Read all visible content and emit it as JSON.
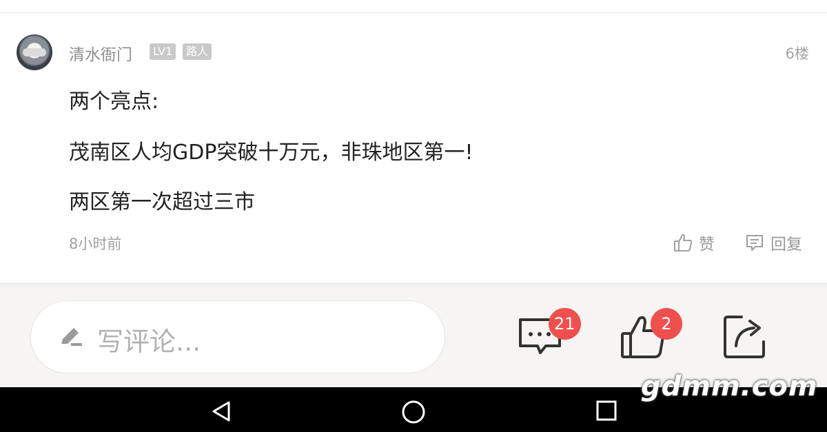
{
  "comment": {
    "username": "清水衙门",
    "level_badge": "LV1",
    "role_badge": "路人",
    "floor": "6楼",
    "lines": [
      "两个亮点:",
      "茂南区人均GDP突破十万元，非珠地区第一!",
      "两区第一次超过三市"
    ],
    "time": "8小时前",
    "like_label": "赞",
    "reply_label": "回复"
  },
  "bottom_bar": {
    "comment_placeholder": "写评论...",
    "comments_count": "21",
    "likes_count": "2"
  },
  "watermark": "gdmm.com",
  "icons": {
    "avatar": "avatar",
    "like": "thumbs-up-icon",
    "reply": "reply-bubble-icon",
    "pencil": "pencil-icon",
    "comments": "comment-bubble-icon",
    "thumbs": "thumbs-up-icon",
    "share": "share-icon",
    "nav_back": "back-triangle-icon",
    "nav_home": "home-circle-icon",
    "nav_recent": "recent-square-icon"
  },
  "colors": {
    "badge_red": "#f0504d",
    "text_main": "#222222",
    "text_muted": "#a0a0a0"
  }
}
